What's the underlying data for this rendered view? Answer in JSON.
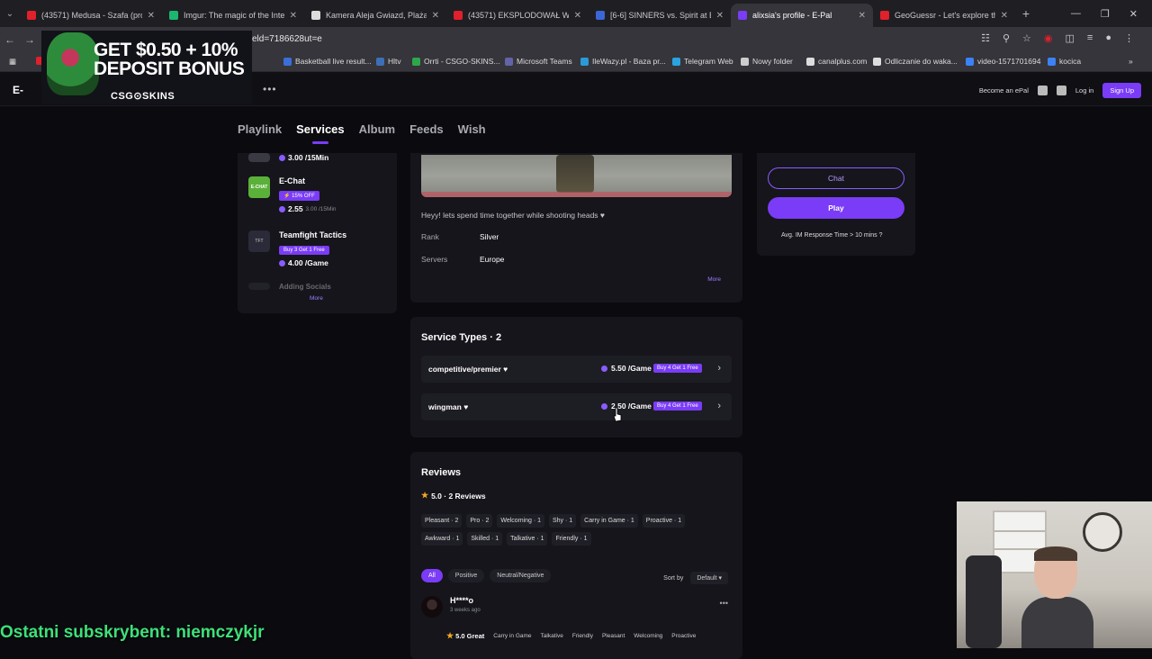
{
  "browser": {
    "tabs": [
      {
        "title": "(43571) Medusa - Szafa (prod.",
        "color": "#e0202a",
        "active": false
      },
      {
        "title": "Imgur: The magic of the Intern",
        "color": "#1bb76e",
        "active": false
      },
      {
        "title": "Kamera Aleja Gwiazd, Plaża, M",
        "color": "#dddddd",
        "active": false
      },
      {
        "title": "(43571) EKSPLODOWAŁ WSZY",
        "color": "#e0202a",
        "active": false
      },
      {
        "title": "[6-6] SINNERS vs. Spirit at BLA",
        "color": "#3a66d6",
        "active": false
      },
      {
        "title": "alixsia's profile - E-Pal",
        "color": "#7a3cf6",
        "active": true
      },
      {
        "title": "GeoGuessr - Let's explore the",
        "color": "#e0202a",
        "active": false
      }
    ],
    "url": "eld=7186628ut=e",
    "bookmarks": [
      {
        "label": "Basketball live result...",
        "color": "#3b6fd8"
      },
      {
        "label": "Hltv",
        "color": "#3d6fb7"
      },
      {
        "label": "Orrti - CSGO-SKINS...",
        "color": "#2ca84a"
      },
      {
        "label": "Microsoft Teams",
        "color": "#6264a7"
      },
      {
        "label": "IleWazy.pl - Baza pr...",
        "color": "#2a9bd7"
      },
      {
        "label": "Telegram Web",
        "color": "#2aa3e0"
      },
      {
        "label": "Nowy folder",
        "color": "#cccccc"
      },
      {
        "label": "canalplus.com",
        "color": "#dddddd"
      },
      {
        "label": "Odliczanie do waka...",
        "color": "#dddddd"
      },
      {
        "label": "video-1571701694",
        "color": "#3b82f6"
      },
      {
        "label": "kocica",
        "color": "#3b82f6"
      }
    ]
  },
  "ad": {
    "line1": "GET $0.50 + 10%",
    "line2": "DEPOSIT BONUS",
    "brand": "CSG⊙SKINS"
  },
  "header": {
    "logo": "E-",
    "become": "Become an ePal",
    "login": "Log in",
    "signup": "Sign Up"
  },
  "subnav": [
    "Playlink",
    "Services",
    "Album",
    "Feeds",
    "Wish"
  ],
  "subnav_active": "Services",
  "left_panel": {
    "top_price": "3.00 /15Min",
    "items": [
      {
        "title": "E-Chat",
        "badge": "15% OFF",
        "price": "2.55",
        "old": "3.00 /15Min",
        "thumb_color": "#5bb03a",
        "thumb_text": "E-CHAT"
      },
      {
        "title": "Teamfight Tactics",
        "badge": "Buy 3 Get 1 Free",
        "price": "4.00 /Game",
        "thumb_color": "#2a2a38",
        "thumb_text": "TFT"
      }
    ],
    "cut_item": "Adding Socials",
    "more": "More"
  },
  "hero": {
    "bio": "Heyy! lets spend time together while shooting heads ♥",
    "rank_label": "Rank",
    "rank_value": "Silver",
    "servers_label": "Servers",
    "servers_value": "Europe",
    "more": "More"
  },
  "services": {
    "title": "Service Types · 2",
    "rows": [
      {
        "name": "competitive/premier ♥",
        "price": "5.50 /Game",
        "badge": "Buy 4 Get 1 Free"
      },
      {
        "name": "wingman ♥",
        "price": "2.50 /Game",
        "badge": "Buy 4 Get 1 Free"
      }
    ]
  },
  "reviews": {
    "title": "Reviews",
    "score": "5.0 · 2 Reviews",
    "tags": [
      "Pleasant · 2",
      "Pro · 2",
      "Welcoming · 1",
      "Shy · 1",
      "Carry in Game · 1",
      "Proactive · 1",
      "Awkward · 1",
      "Skilled · 1",
      "Talkative · 1",
      "Friendly · 1"
    ],
    "filters": [
      "All",
      "Positive",
      "Neutral/Negative"
    ],
    "sort_label": "Sort by",
    "sort_value": "Default",
    "reviewer": {
      "name": "H****o",
      "date": "3 weeks ago",
      "score": "5.0 Great",
      "tags": [
        "Carry in Game",
        "Talkative",
        "Friendly",
        "Pleasant",
        "Welcoming",
        "Proactive"
      ]
    }
  },
  "right_panel": {
    "chat": "Chat",
    "play": "Play",
    "response": "Avg. IM Response Time > 10 mins"
  },
  "overlay": {
    "subscriber": "Ostatni subskrybent: niemczykjr"
  },
  "colors": {
    "accent": "#7a3cf6",
    "background": "#0b0b0f",
    "card": "#15151b"
  }
}
